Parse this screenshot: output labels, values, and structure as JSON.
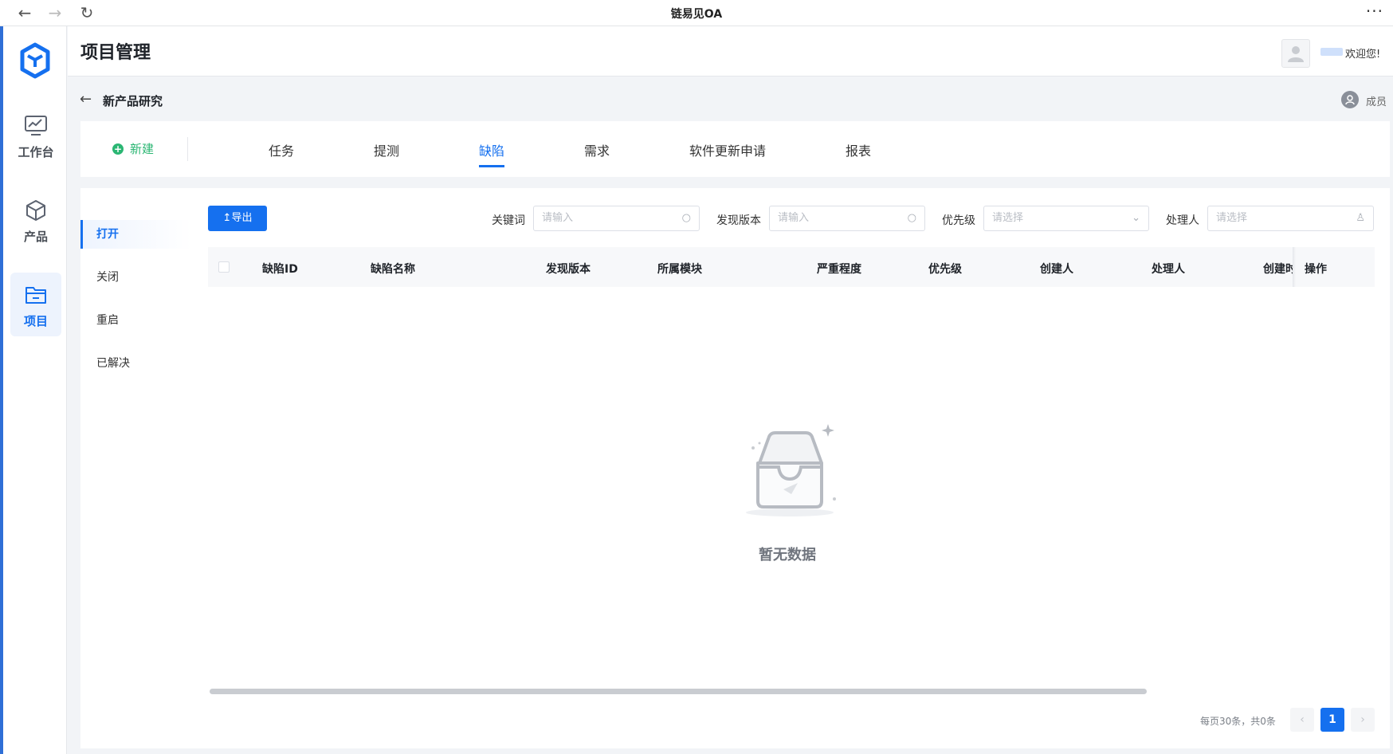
{
  "browser": {
    "title": "链易见OA",
    "back_icon": "←",
    "forward_icon": "→",
    "reload_icon": "↻",
    "more_icon": "···"
  },
  "sidebar": {
    "items": [
      {
        "label": "工作台",
        "icon": "dashboard-icon"
      },
      {
        "label": "产品",
        "icon": "cube-icon"
      },
      {
        "label": "项目",
        "icon": "folder-icon",
        "active": true
      }
    ]
  },
  "header": {
    "title": "项目管理",
    "welcome": "欢迎您!"
  },
  "breadcrumb": {
    "back_icon": "←",
    "title": "新产品研究",
    "member_label": "成员"
  },
  "tabs": {
    "new_label": "新建",
    "items": [
      "任务",
      "提测",
      "缺陷",
      "需求",
      "软件更新申请",
      "报表"
    ],
    "active": "缺陷"
  },
  "status_filter": {
    "items": [
      "打开",
      "关闭",
      "重启",
      "已解决"
    ],
    "active": "打开"
  },
  "toolbar": {
    "export_label": "↥导出"
  },
  "filters": {
    "keyword_label": "关键词",
    "keyword_placeholder": "请输入",
    "version_label": "发现版本",
    "version_placeholder": "请输入",
    "priority_label": "优先级",
    "priority_placeholder": "请选择",
    "handler_label": "处理人",
    "handler_placeholder": "请选择"
  },
  "table": {
    "columns": [
      "缺陷ID",
      "缺陷名称",
      "发现版本",
      "所属模块",
      "严重程度",
      "优先级",
      "创建人",
      "处理人",
      "创建时",
      "操作"
    ],
    "rows": [],
    "empty_text": "暂无数据"
  },
  "pagination": {
    "summary": "每页30条，共0条",
    "prev": "‹",
    "current": "1",
    "next": "›"
  },
  "colors": {
    "primary": "#1570ef",
    "success": "#2bb673",
    "accent_stripe": "#2f6fd6"
  }
}
